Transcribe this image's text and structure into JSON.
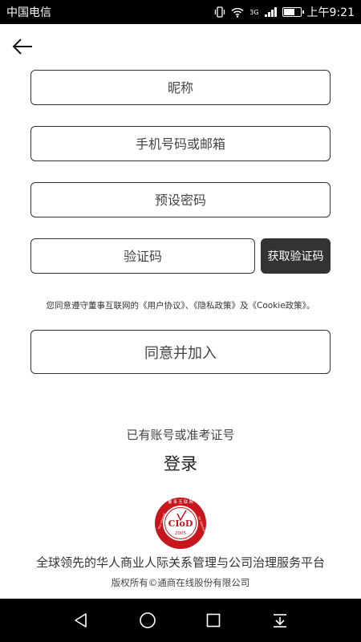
{
  "status_bar": {
    "carrier": "中国电信",
    "network": "3G",
    "time": "上午9:21"
  },
  "form": {
    "nickname_placeholder": "昵称",
    "phone_email_placeholder": "手机号码或邮箱",
    "password_placeholder": "预设密码",
    "code_placeholder": "验证码",
    "get_code_label": "获取验证码"
  },
  "agreement_text": "您同意遵守董事互联网的《用户协议》、《隐私政策》及《Cookie政策》。",
  "agree_button_label": "同意并加入",
  "have_account_text": "已有账号或准考证号",
  "login_label": "登录",
  "logo": {
    "top_text": "董事互联网",
    "center_text": "CIoD",
    "side_text": "The Internet for Directors",
    "year": "2005",
    "color": "#c8161d"
  },
  "slogan": "全球领先的华人商业人际关系管理与公司治理服务平台",
  "copyright": "版权所有©通商在线股份有限公司",
  "nav_icons": [
    "back-icon",
    "home-icon",
    "recents-icon",
    "notification-pull-icon"
  ]
}
